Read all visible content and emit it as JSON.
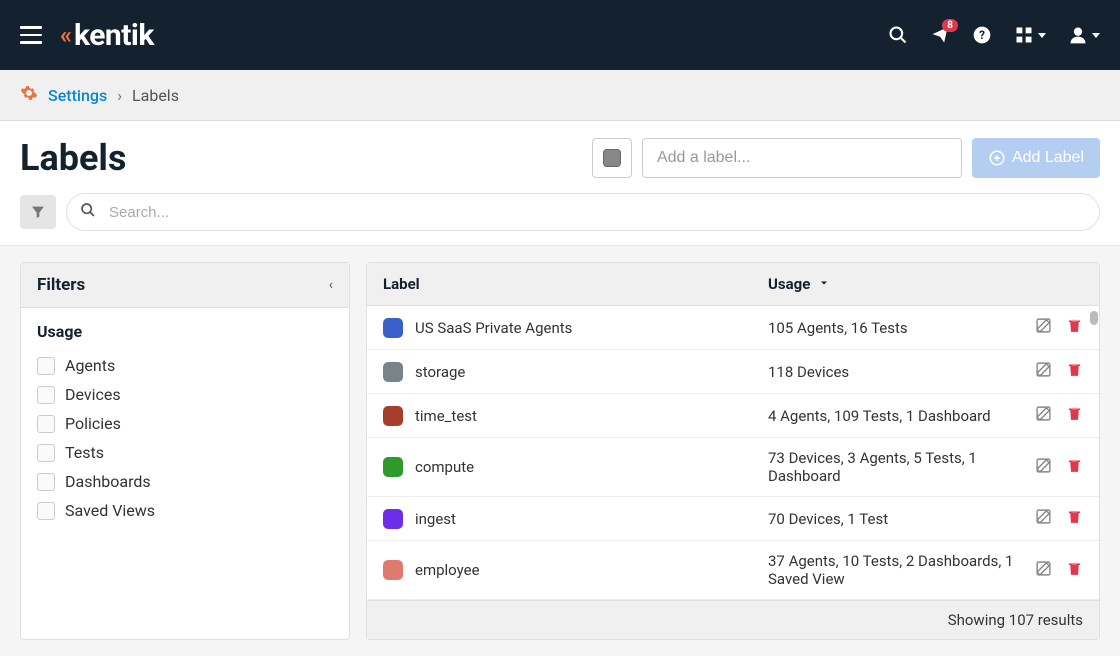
{
  "header": {
    "brand": "kentik",
    "notification_count": "8"
  },
  "breadcrumb": {
    "root": "Settings",
    "current": "Labels"
  },
  "page": {
    "title": "Labels",
    "add_label_placeholder": "Add a label...",
    "add_label_button": "Add Label",
    "search_placeholder": "Search..."
  },
  "filters": {
    "title": "Filters",
    "group_title": "Usage",
    "items": [
      {
        "label": "Agents"
      },
      {
        "label": "Devices"
      },
      {
        "label": "Policies"
      },
      {
        "label": "Tests"
      },
      {
        "label": "Dashboards"
      },
      {
        "label": "Saved Views"
      }
    ]
  },
  "table": {
    "columns": {
      "label": "Label",
      "usage": "Usage"
    },
    "rows": [
      {
        "color": "#3b5fc9",
        "name": "US SaaS Private Agents",
        "usage": "105 Agents, 16 Tests"
      },
      {
        "color": "#7a828a",
        "name": "storage",
        "usage": "118 Devices"
      },
      {
        "color": "#a53e2c",
        "name": "time_test",
        "usage": "4 Agents, 109 Tests, 1 Dashboard"
      },
      {
        "color": "#2e9a2e",
        "name": "compute",
        "usage": "73 Devices, 3 Agents, 5 Tests, 1 Dashboard"
      },
      {
        "color": "#6e2ee8",
        "name": "ingest",
        "usage": "70 Devices, 1 Test"
      },
      {
        "color": "#e07a6e",
        "name": "employee",
        "usage": "37 Agents, 10 Tests, 2 Dashboards, 1 Saved View"
      }
    ],
    "footer": "Showing 107 results"
  }
}
